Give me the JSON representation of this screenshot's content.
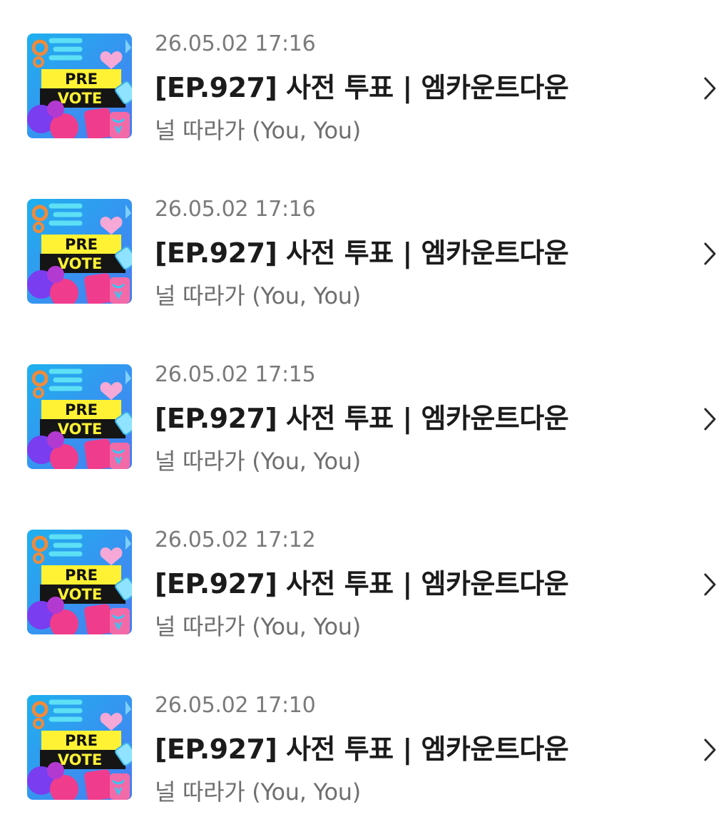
{
  "items": [
    {
      "date": "26.05.02 17:16",
      "title": "[EP.927] 사전 투표 | 엠카운트다운",
      "artist": "널 따라가 (You, You)",
      "thumb_top": "PRE",
      "thumb_bottom": "VOTE"
    },
    {
      "date": "26.05.02 17:16",
      "title": "[EP.927] 사전 투표 | 엠카운트다운",
      "artist": "널 따라가 (You, You)",
      "thumb_top": "PRE",
      "thumb_bottom": "VOTE"
    },
    {
      "date": "26.05.02 17:15",
      "title": "[EP.927] 사전 투표 | 엠카운트다운",
      "artist": "널 따라가 (You, You)",
      "thumb_top": "PRE",
      "thumb_bottom": "VOTE"
    },
    {
      "date": "26.05.02 17:12",
      "title": "[EP.927] 사전 투표 | 엠카운트다운",
      "artist": "널 따라가 (You, You)",
      "thumb_top": "PRE",
      "thumb_bottom": "VOTE"
    },
    {
      "date": "26.05.02 17:10",
      "title": "[EP.927] 사전 투표 | 엠카운트다운",
      "artist": "널 따라가 (You, You)",
      "thumb_top": "PRE",
      "thumb_bottom": "VOTE"
    }
  ],
  "icons": {
    "chevron": "chevron-right-icon",
    "thumbnail": "pre-vote-thumbnail"
  },
  "colors": {
    "date": "#7a7a7a",
    "title": "#1b1b1b",
    "artist": "#6f6f6f",
    "thumb_bg": "#2aa6f2",
    "thumb_yellow": "#fff234",
    "thumb_pink": "#f03c8c",
    "thumb_purple": "#7a3df0"
  }
}
